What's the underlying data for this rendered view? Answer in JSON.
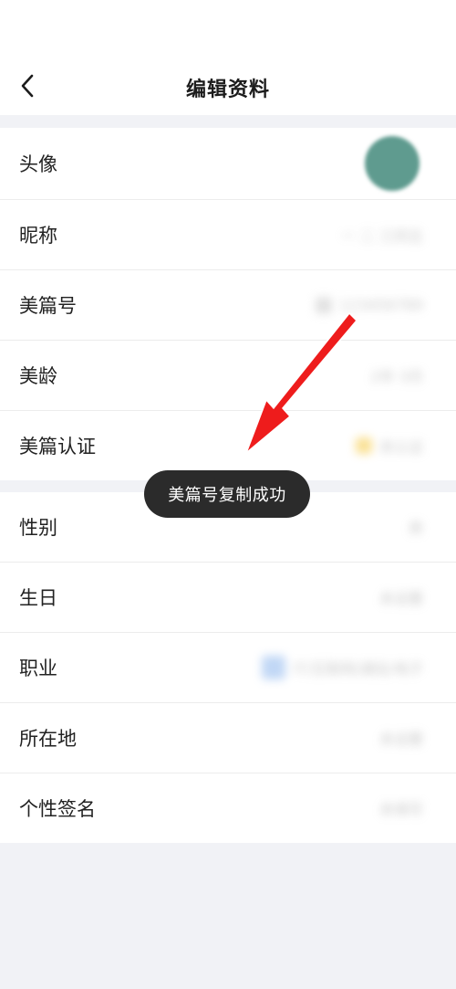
{
  "nav": {
    "title": "编辑资料"
  },
  "group1": {
    "rows": [
      {
        "label": "头像"
      },
      {
        "label": "昵称",
        "value": "一 二 三四五"
      },
      {
        "label": "美篇号",
        "value": "123456789"
      },
      {
        "label": "美龄",
        "value": "2年 3月"
      },
      {
        "label": "美篇认证",
        "value": "未认证"
      }
    ]
  },
  "group2": {
    "rows": [
      {
        "label": "性别",
        "value": "男"
      },
      {
        "label": "生日",
        "value": "未设置"
      },
      {
        "label": "职业",
        "value": "IT/互联网/通信/电子"
      },
      {
        "label": "所在地",
        "value": "未设置"
      },
      {
        "label": "个性签名",
        "value": "未填写"
      }
    ]
  },
  "toast": {
    "text": "美篇号复制成功"
  },
  "colors": {
    "annotation_arrow": "#ee1c1c",
    "avatar": "#5f9b8f",
    "toast_bg": "#2b2b2b"
  }
}
